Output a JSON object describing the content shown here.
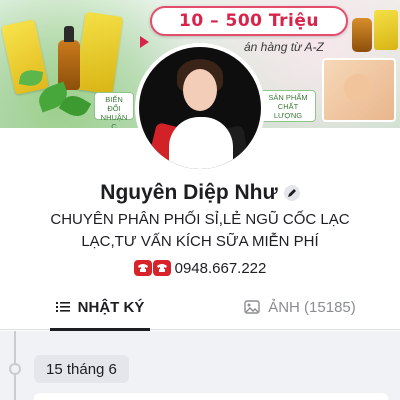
{
  "cover": {
    "promo_title": "10 – 500 Triệu",
    "promo_subtitle": "án hàng từ A-Z",
    "tag_left": "BIẾN ĐỔI NHUẬN C",
    "tag_right": "SẢN PHẨM CHẤT LƯỢNG"
  },
  "profile": {
    "name": "Nguyên Diệp Như",
    "bio_line1": "CHUYÊN PHÂN PHỐI SỈ,LẺ NGŨ CỐC LẠC",
    "bio_line2": "LẠC,TƯ VẤN KÍCH SỮA MIỄN PHÍ",
    "phone": "0948.667.222"
  },
  "tabs": {
    "diary": "NHẬT KÝ",
    "photos": "ẢNH (15185)"
  },
  "timeline": {
    "date": "15 tháng 6"
  },
  "icons": [
    "edit-icon",
    "phone-icon",
    "list-icon",
    "photo-icon"
  ],
  "colors": {
    "accent_red": "#d8232a",
    "text": "#1c1e21",
    "muted": "#8a8d91"
  }
}
